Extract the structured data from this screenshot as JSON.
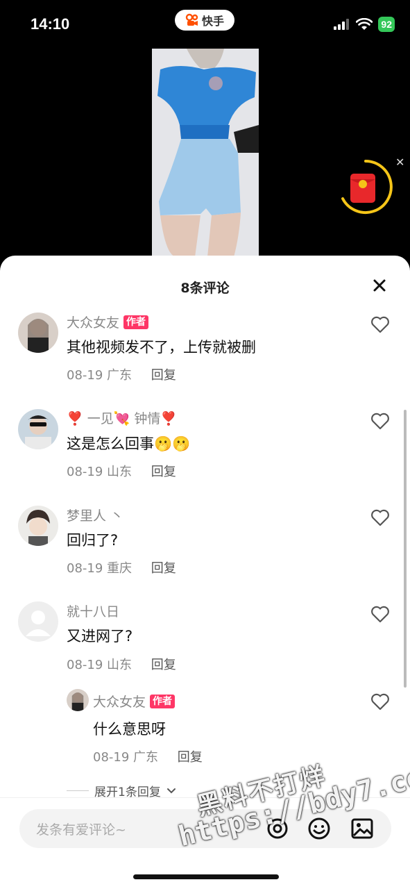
{
  "status_bar": {
    "time": "14:10",
    "app_name": "快手",
    "battery": "92"
  },
  "sheet": {
    "title": "8条评论"
  },
  "comments": [
    {
      "user": "大众女友",
      "badge": "作者",
      "text": "其他视频发不了，上传就被删",
      "date": "08-19",
      "location": "广东",
      "reply_label": "回复"
    },
    {
      "user": "❣️ 一见💘 钟情❣️",
      "text": "这是怎么回事🫢🫢",
      "date": "08-19",
      "location": "山东",
      "reply_label": "回复"
    },
    {
      "user": "梦里人 丶",
      "text": "回归了?",
      "date": "08-19",
      "location": "重庆",
      "reply_label": "回复"
    },
    {
      "user": "就十八日",
      "text": "又进网了?",
      "date": "08-19",
      "location": "山东",
      "reply_label": "回复"
    }
  ],
  "reply": {
    "user": "大众女友",
    "badge": "作者",
    "text": "什么意思呀",
    "date": "08-19",
    "location": "广东",
    "reply_label": "回复"
  },
  "expand_label": "展开1条回复",
  "input": {
    "placeholder": "发条有爱评论~"
  },
  "watermark": {
    "line1": "黑料不打烊",
    "line2": "https://bdy7.co"
  },
  "colors": {
    "author_badge": "#fe3666",
    "battery": "#34c759",
    "red_packet": "#e8282b",
    "ring": "#f5c518"
  }
}
